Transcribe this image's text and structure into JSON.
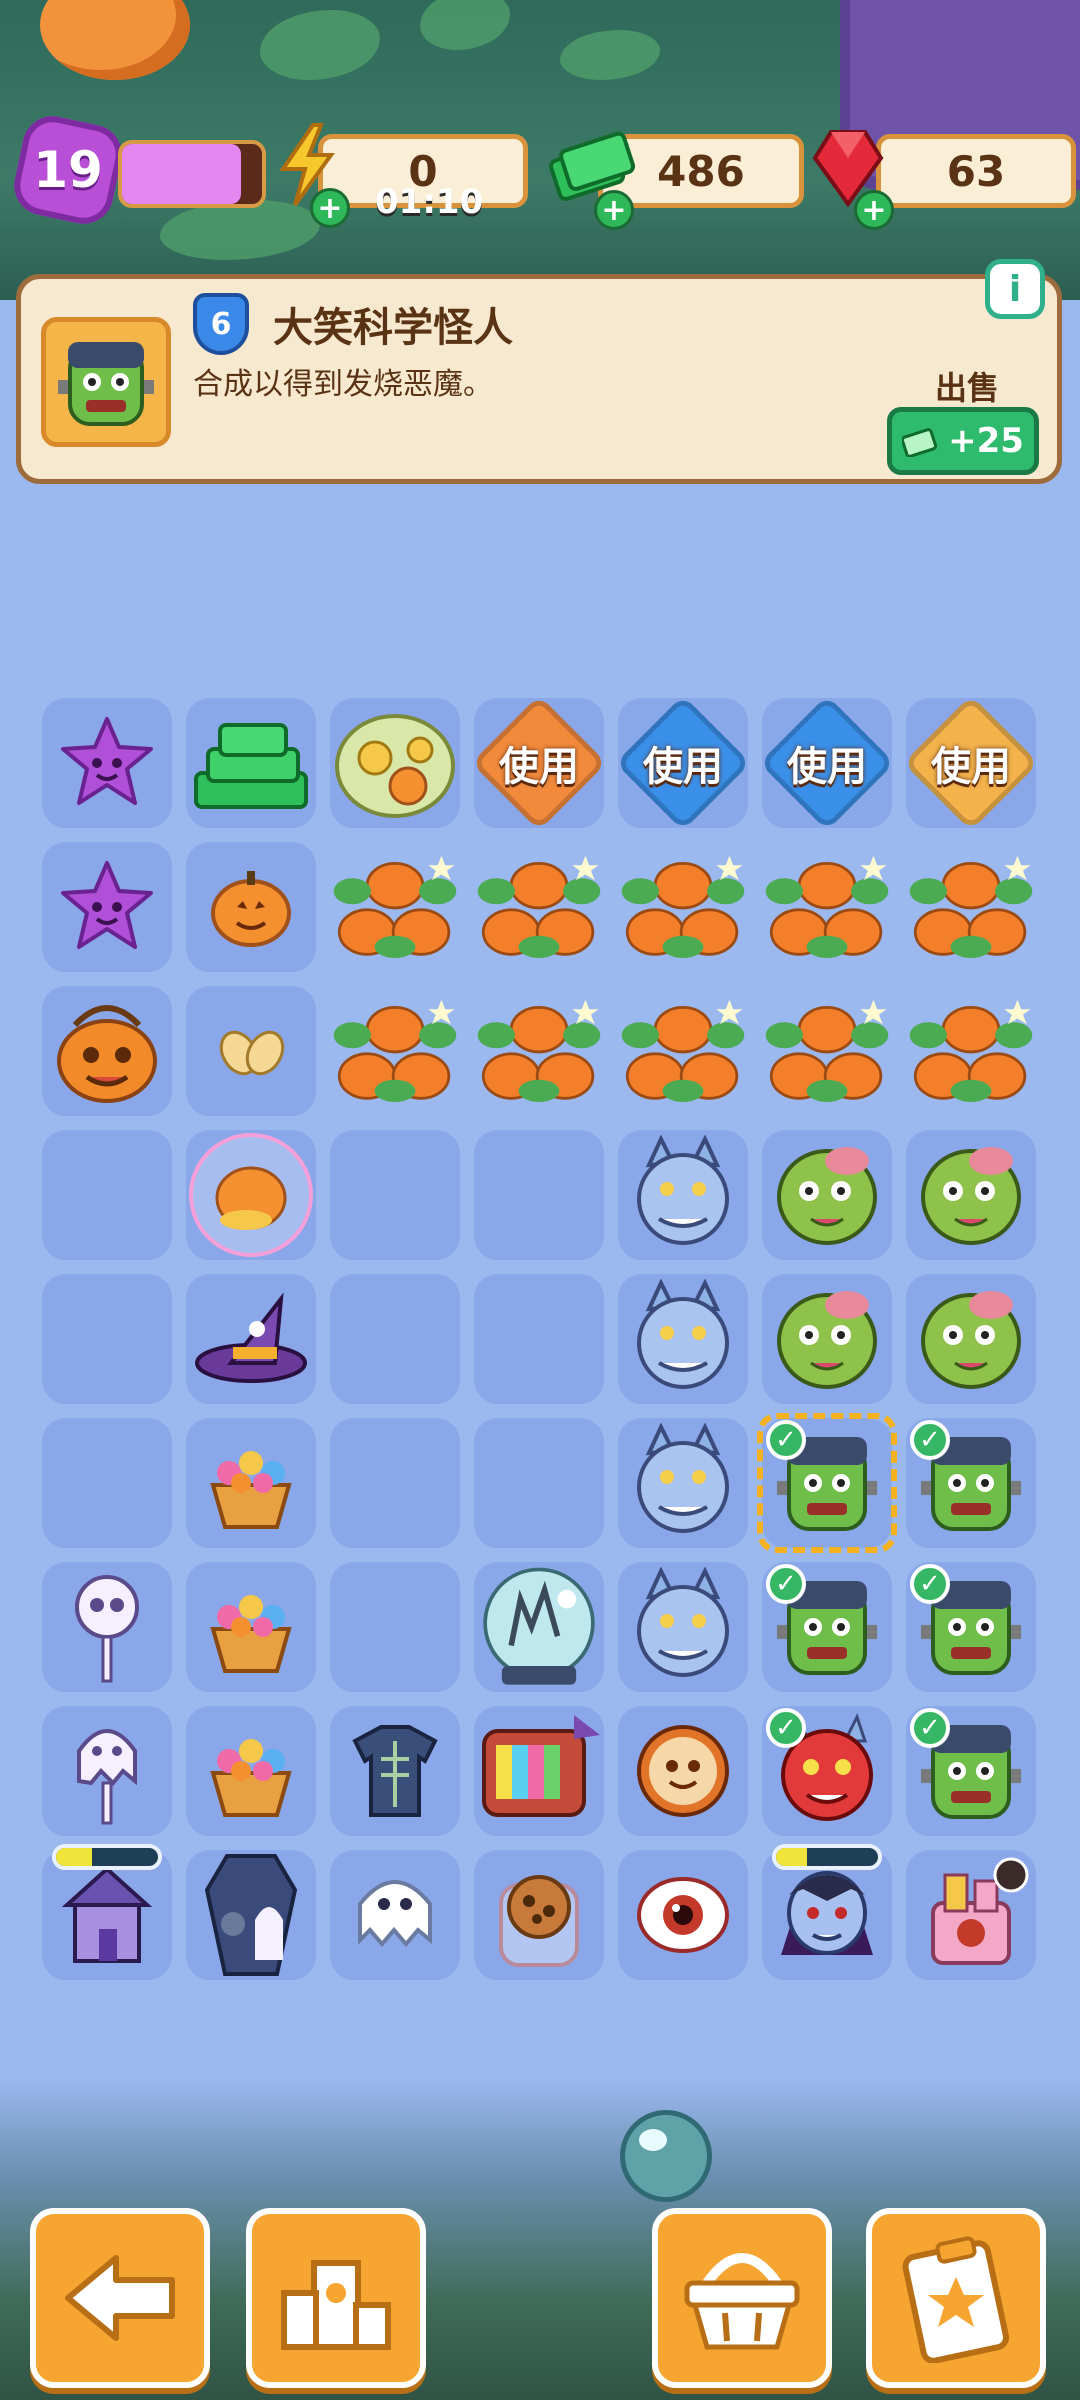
{
  "hud": {
    "level": "19",
    "xp_fraction": 0.85,
    "energy": "0",
    "energy_timer": "01:10",
    "cash": "486",
    "gems": "63"
  },
  "info": {
    "level": "6",
    "title": "大笑科学怪人",
    "description": "合成以得到发烧恶魔。",
    "sell_label": "出售",
    "sell_value": "+25",
    "info_icon": "i"
  },
  "use_label": "使用",
  "colors": {
    "board_bg": "#9bb8ef",
    "cell_bg": "#8aa7ea",
    "accent_orange": "#f6a630",
    "accent_green": "#2ebb6d",
    "use_orange": "#f28a3c",
    "use_blue": "#3a8fe8",
    "use_gold": "#f3b24c"
  },
  "board": {
    "rows": [
      [
        "star-purple-icon",
        "cash-stack-icon",
        "pumpkin-coin-pile-icon",
        "use-orange",
        "use-blue",
        "use-blue",
        "use-gold"
      ],
      [
        "star-purple-icon",
        "pumpkin-small-icon",
        "pumpkin-patch-icon",
        "pumpkin-patch-icon",
        "pumpkin-patch-icon",
        "pumpkin-patch-icon",
        "pumpkin-patch-icon"
      ],
      [
        "pumpkin-bucket-icon",
        "seeds-icon",
        "pumpkin-patch-icon",
        "pumpkin-patch-icon",
        "pumpkin-patch-icon",
        "pumpkin-patch-icon",
        "pumpkin-patch-icon"
      ],
      [
        "",
        "pumpkin-bubble-icon",
        "",
        "",
        "werewolf-icon",
        "zombie-head-icon",
        "zombie-head-icon"
      ],
      [
        "",
        "witch-hat-icon",
        "",
        "",
        "werewolf-icon",
        "zombie-head-icon",
        "zombie-head-icon"
      ],
      [
        "",
        "flower-basket-icon",
        "",
        "",
        "werewolf-icon",
        "frankenstein-icon",
        "frankenstein-icon"
      ],
      [
        "skull-pop-icon",
        "flower-basket-icon",
        "",
        "haunted-globe-icon",
        "werewolf-icon",
        "frankenstein-icon",
        "frankenstein-icon"
      ],
      [
        "ghost-pop-icon",
        "flower-basket-icon",
        "skeleton-shirt-icon",
        "retro-tv-icon",
        "cookie-icon",
        "red-demon-icon",
        "frankenstein-icon"
      ],
      [
        "haunted-house-icon",
        "coffin-ghost-icon",
        "ghost-icon",
        "cookie-jar-icon",
        "eyeball-icon",
        "vampire-icon",
        "candy-castle-icon"
      ]
    ],
    "checked": [
      [
        5,
        5
      ],
      [
        5,
        6
      ],
      [
        6,
        5
      ],
      [
        6,
        6
      ],
      [
        7,
        5
      ],
      [
        7,
        6
      ]
    ],
    "selected": [
      5,
      5
    ],
    "progress": [
      {
        "row": 8,
        "col": 0,
        "fraction": 0.35
      },
      {
        "row": 8,
        "col": 5,
        "fraction": 0.3
      }
    ]
  },
  "nav": [
    {
      "name": "back-button",
      "icon": "arrow-left-icon"
    },
    {
      "name": "leaderboard-button",
      "icon": "podium-icon"
    },
    {
      "name": "shop-button",
      "icon": "basket-icon"
    },
    {
      "name": "tasks-button",
      "icon": "clipboard-star-icon"
    }
  ]
}
